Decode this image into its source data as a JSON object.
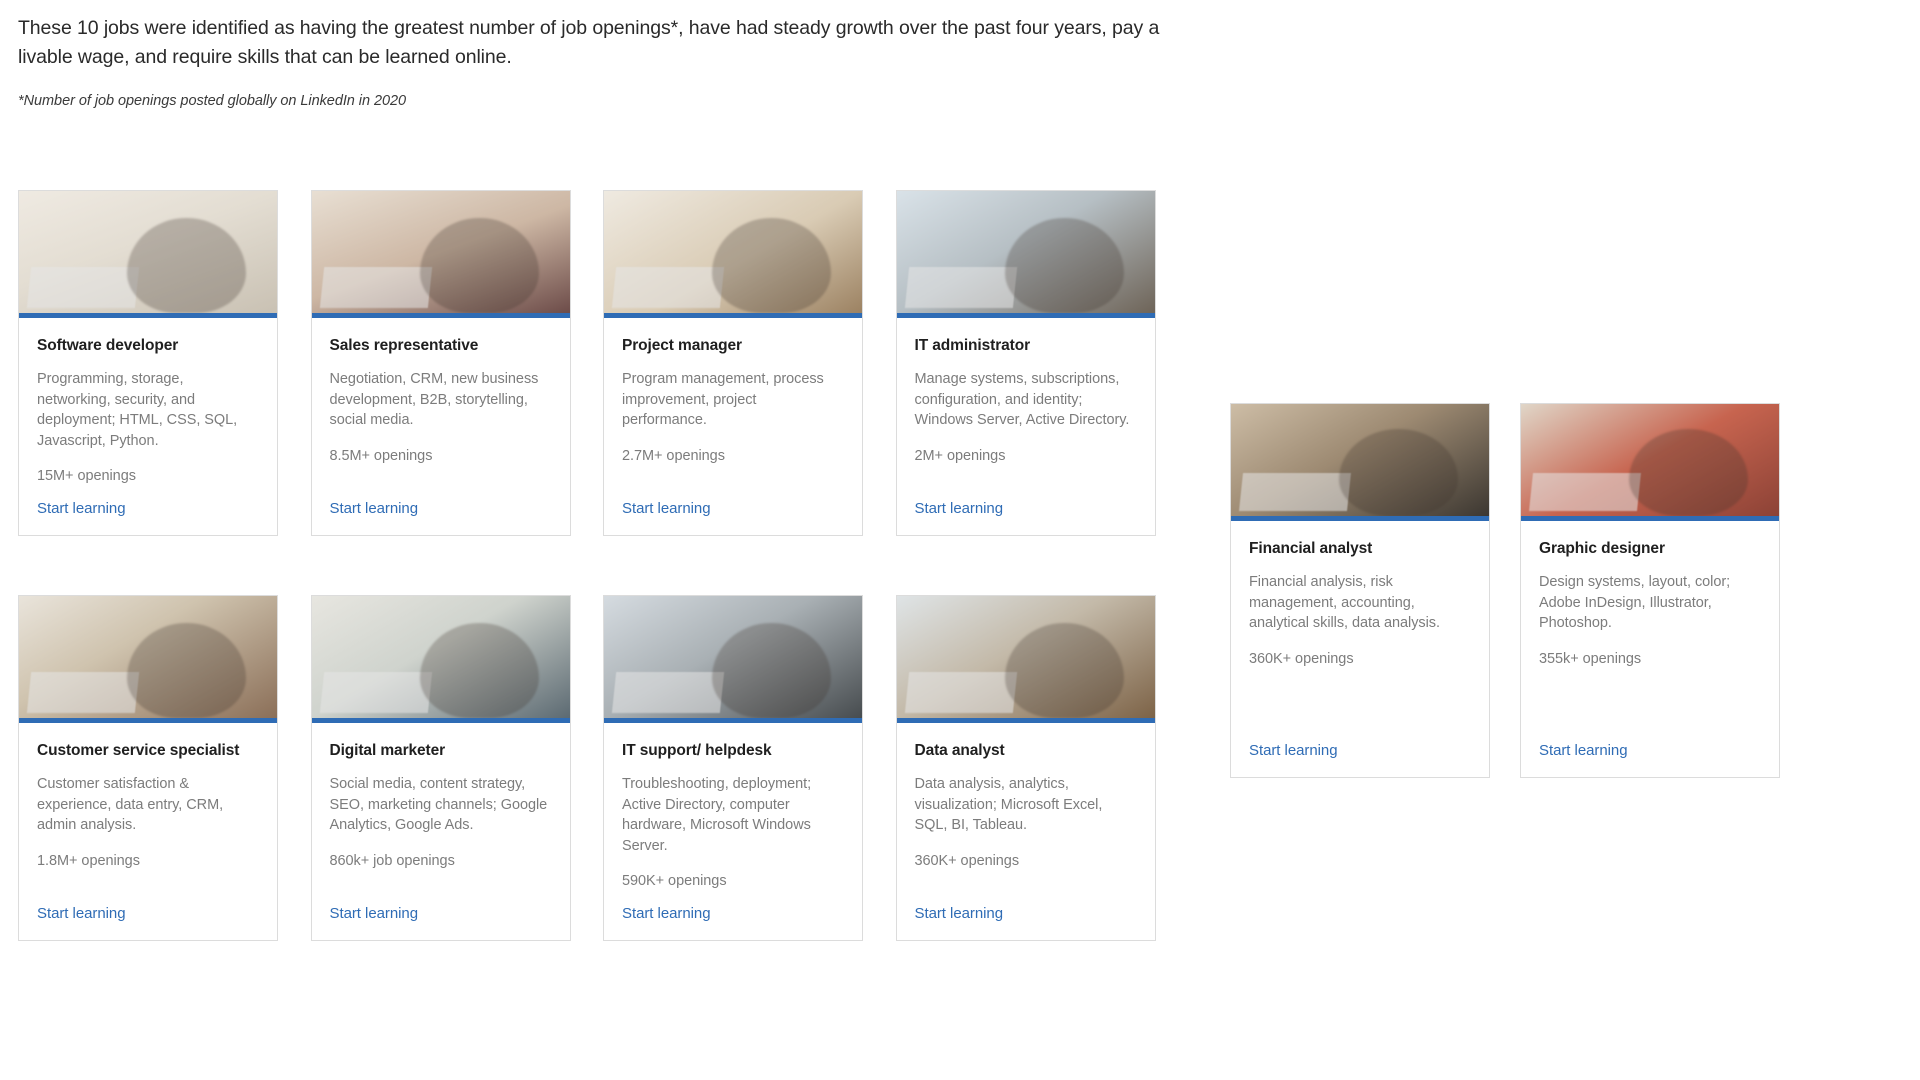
{
  "intro": {
    "lead": "These 10 jobs were identified as having the greatest number of job openings*, have had steady growth over the past four years, pay a livable wage, and require skills that can be learned online.",
    "footnote": "*Number of job openings posted globally on LinkedIn in 2020"
  },
  "accent_color": "#2f6cb5",
  "link_label": "Start learning",
  "cards": [
    {
      "title": "Software developer",
      "description": "Programming, storage, networking, security, and deployment; HTML, CSS, SQL, Javascript, Python.",
      "openings": "15M+ openings",
      "link": "Start learning",
      "photo": "woman-at-laptop-office"
    },
    {
      "title": "Sales representative",
      "description": "Negotiation, CRM, new business development, B2B, storytelling, social media.",
      "openings": "8.5M+ openings",
      "link": "Start learning",
      "photo": "man-on-phone-at-desk"
    },
    {
      "title": "Project manager",
      "description": "Program management, process improvement, project performance.",
      "openings": "2.7M+ openings",
      "link": "Start learning",
      "photo": "woman-with-papers-in-shop"
    },
    {
      "title": "IT administrator",
      "description": "Manage systems, subscriptions, configuration, and identity; Windows Server, Active Directory.",
      "openings": "2M+ openings",
      "link": "Start learning",
      "photo": "man-at-desk-by-window"
    },
    {
      "title": "Customer service specialist",
      "description": "Customer satisfaction & experience, data entry, CRM, admin analysis.",
      "openings": "1.8M+ openings",
      "link": "Start learning",
      "photo": "woman-smiling-at-laptop"
    },
    {
      "title": "Digital marketer",
      "description": "Social media, content strategy, SEO, marketing channels; Google Analytics, Google Ads.",
      "openings": "860k+ job openings",
      "link": "Start learning",
      "photo": "woman-working-at-home"
    },
    {
      "title": "IT support/ helpdesk",
      "description": "Troubleshooting, deployment; Active Directory, computer hardware, Microsoft Windows Server.",
      "openings": "590K+ openings",
      "link": "Start learning",
      "photo": "man-with-headset-at-monitor"
    },
    {
      "title": "Data analyst",
      "description": "Data analysis, analytics, visualization; Microsoft Excel, SQL, BI, Tableau.",
      "openings": "360K+ openings",
      "link": "Start learning",
      "photo": "woman-with-headset-in-library"
    }
  ],
  "float_cards": [
    {
      "title": "Financial analyst",
      "description": "Financial analysis, risk management, accounting, analytical skills, data analysis.",
      "openings": "360K+ openings",
      "link": "Start learning",
      "photo": "man-at-laptop-in-loft-office"
    },
    {
      "title": "Graphic designer",
      "description": "Design systems, layout, color; Adobe InDesign, Illustrator, Photoshop.",
      "openings": "355k+ openings",
      "link": "Start learning",
      "photo": "woman-on-red-sofa-with-laptop"
    }
  ]
}
